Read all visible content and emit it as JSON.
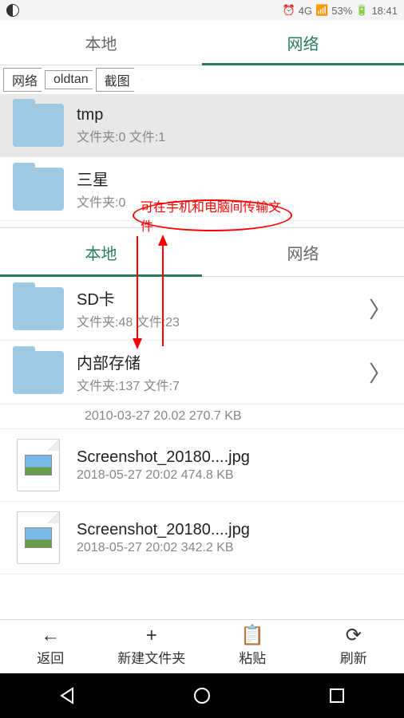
{
  "status": {
    "battery": "53%",
    "time": "18:41",
    "signal": "4G"
  },
  "tabs_top": {
    "local": "本地",
    "network": "网络"
  },
  "breadcrumb": [
    "网络",
    "oldtan",
    "截图"
  ],
  "items_top": [
    {
      "name": "tmp",
      "sub": "文件夹:0 文件:1"
    },
    {
      "name": "三星",
      "sub": "文件夹:0"
    }
  ],
  "annotation_text": "可在手机和电脑间传输文件",
  "tabs_mid": {
    "local": "本地",
    "network": "网络"
  },
  "items_mid": [
    {
      "name": "SD卡",
      "sub": "文件夹:48 文件:23",
      "chevron": true
    },
    {
      "name": "内部存储",
      "sub": "文件夹:137 文件:7",
      "chevron": true
    }
  ],
  "partial_row": "2010-03-27 20.02 270.7 KB",
  "files": [
    {
      "name": "Screenshot_20180....jpg",
      "sub": "2018-05-27 20:02 474.8 KB"
    },
    {
      "name": "Screenshot_20180....jpg",
      "sub": "2018-05-27 20:02 342.2 KB"
    }
  ],
  "toolbar": {
    "back": "返回",
    "newfolder": "新建文件夹",
    "paste": "粘贴",
    "refresh": "刷新"
  }
}
